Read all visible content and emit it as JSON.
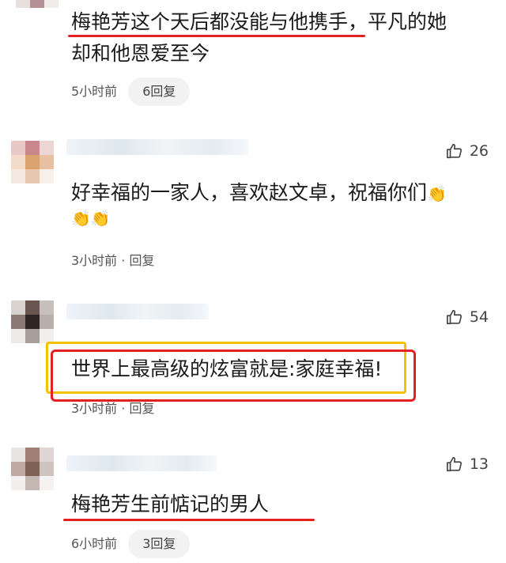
{
  "comments": [
    {
      "text_line1": "梅艳芳这个天后都没能与他携手，平凡的她",
      "text_line2": "却和他恩爱至今",
      "time": "5小时前",
      "reply": "6回复"
    },
    {
      "likes": "26",
      "text_line1": "好幸福的一家人，喜欢赵文卓，祝福你们",
      "time": "3小时前",
      "reply": "回复",
      "separator": "·"
    },
    {
      "likes": "54",
      "text_line1": "世界上最高级的炫富就是:家庭幸福!",
      "time": "3小时前",
      "reply": "回复",
      "separator": "·"
    },
    {
      "likes": "13",
      "text_line1": "梅艳芳生前惦记的男人",
      "time": "6小时前",
      "reply": "3回复"
    }
  ],
  "colors": {
    "highlight_red": "#e52020",
    "highlight_yellow": "#f2c200"
  },
  "icons": {
    "like": "thumbs-up-icon",
    "emoji": "clapping-hands-icon"
  }
}
